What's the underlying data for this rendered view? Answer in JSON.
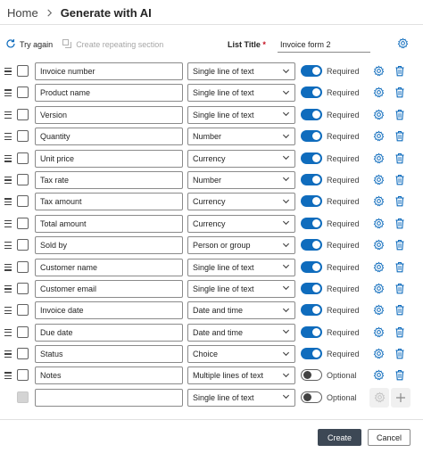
{
  "breadcrumb": {
    "home": "Home",
    "current": "Generate with AI"
  },
  "toolbar": {
    "try_again": "Try again",
    "create_repeating": "Create repeating section",
    "list_title_label": "List Title",
    "list_title_required": "*",
    "list_title_value": "Invoice form 2"
  },
  "colors": {
    "accent": "#0f6cbd",
    "primary_button": "#3d4855"
  },
  "rows": [
    {
      "name": "Invoice number",
      "type": "Single line of text",
      "required": true,
      "req_label": "Required"
    },
    {
      "name": "Product name",
      "type": "Single line of text",
      "required": true,
      "req_label": "Required"
    },
    {
      "name": "Version",
      "type": "Single line of text",
      "required": true,
      "req_label": "Required"
    },
    {
      "name": "Quantity",
      "type": "Number",
      "required": true,
      "req_label": "Required"
    },
    {
      "name": "Unit price",
      "type": "Currency",
      "required": true,
      "req_label": "Required"
    },
    {
      "name": "Tax rate",
      "type": "Number",
      "required": true,
      "req_label": "Required"
    },
    {
      "name": "Tax amount",
      "type": "Currency",
      "required": true,
      "req_label": "Required"
    },
    {
      "name": "Total amount",
      "type": "Currency",
      "required": true,
      "req_label": "Required"
    },
    {
      "name": "Sold by",
      "type": "Person or group",
      "required": true,
      "req_label": "Required"
    },
    {
      "name": "Customer name",
      "type": "Single line of text",
      "required": true,
      "req_label": "Required"
    },
    {
      "name": "Customer email",
      "type": "Single line of text",
      "required": true,
      "req_label": "Required"
    },
    {
      "name": "Invoice date",
      "type": "Date and time",
      "required": true,
      "req_label": "Required"
    },
    {
      "name": "Due date",
      "type": "Date and time",
      "required": true,
      "req_label": "Required"
    },
    {
      "name": "Status",
      "type": "Choice",
      "required": true,
      "req_label": "Required"
    },
    {
      "name": "Notes",
      "type": "Multiple lines of text",
      "required": false,
      "req_label": "Optional"
    }
  ],
  "new_row": {
    "name": "",
    "type": "Single line of text",
    "req_label": "Optional"
  },
  "footer": {
    "create": "Create",
    "cancel": "Cancel"
  }
}
